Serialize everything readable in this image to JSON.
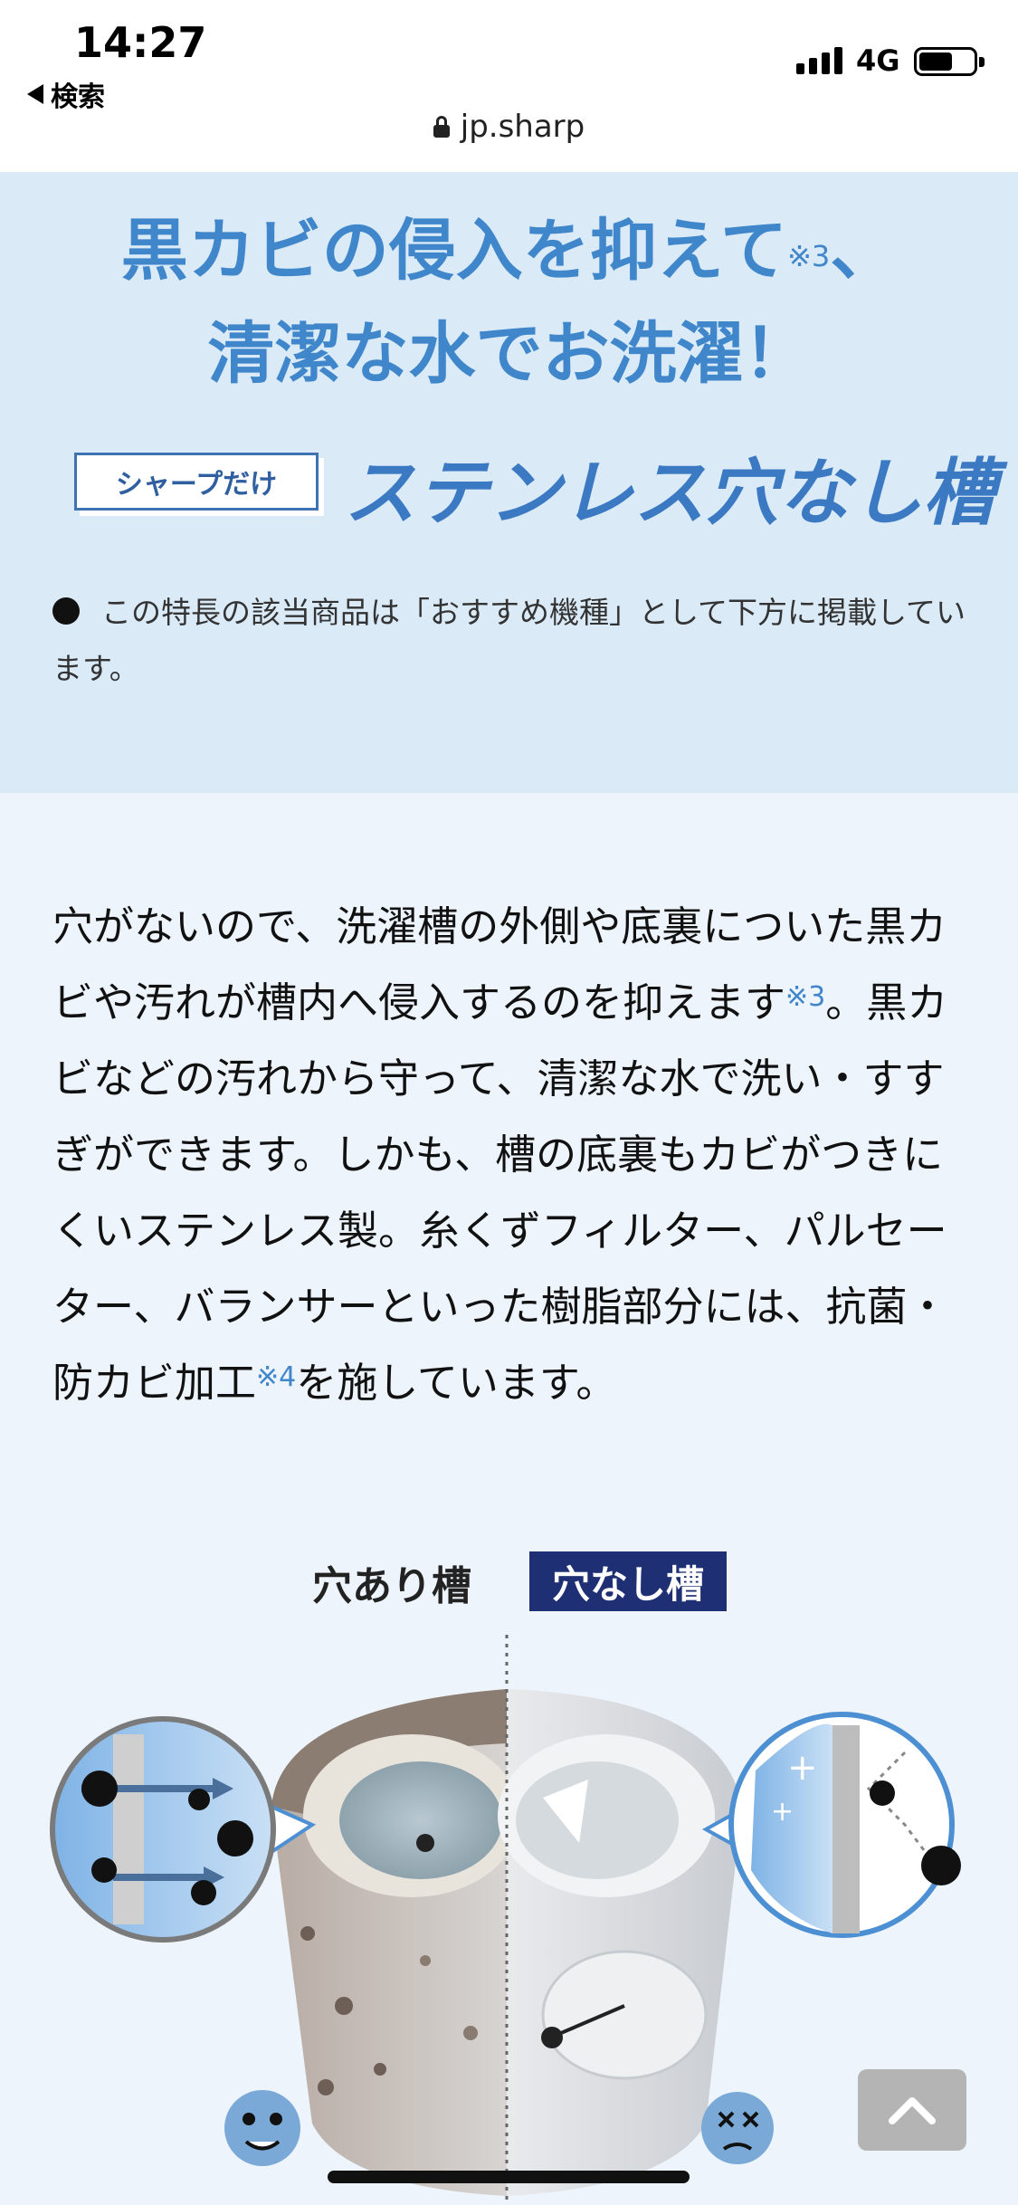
{
  "status_bar": {
    "time": "14:27",
    "back_label": "検索",
    "network": "4G"
  },
  "browser": {
    "url": "jp.sharp"
  },
  "hero": {
    "headline_line1": "黒カビの侵入を抑えて",
    "headline_note": "※3",
    "headline_comma": "、",
    "headline_line2": "清潔な水でお洗濯！",
    "badge": "シャープだけ",
    "feature_title": "ステンレス穴なし槽",
    "note": "この特長の該当商品は「おすすめ機種」として下方に掲載しています。"
  },
  "description": {
    "part1": "穴がないので、洗濯槽の外側や底裏についた黒カビや汚れが槽内へ侵入するのを抑えます",
    "note1": "※3",
    "part2": "。黒カビなどの汚れから守って、清潔な水で洗い・すすぎができます。しかも、槽の底裏もカビがつきにくいステンレス製。糸くずフィルター、パルセーター、バランサーといった樹脂部分には、抗菌・防カビ加工",
    "note2": "※4",
    "part3": "を施しています。"
  },
  "comparison": {
    "label_with_holes": "穴あり槽",
    "label_no_holes": "穴なし槽"
  },
  "colors": {
    "accent_blue": "#3f86cb",
    "hero_bg": "#daeaf7",
    "main_bg": "#edf4fb",
    "navy": "#1e2f73"
  },
  "icons": [
    "back-arrow-icon",
    "signal-icon",
    "battery-icon",
    "lock-icon",
    "mold-germ-icon",
    "arrow-up-icon"
  ]
}
